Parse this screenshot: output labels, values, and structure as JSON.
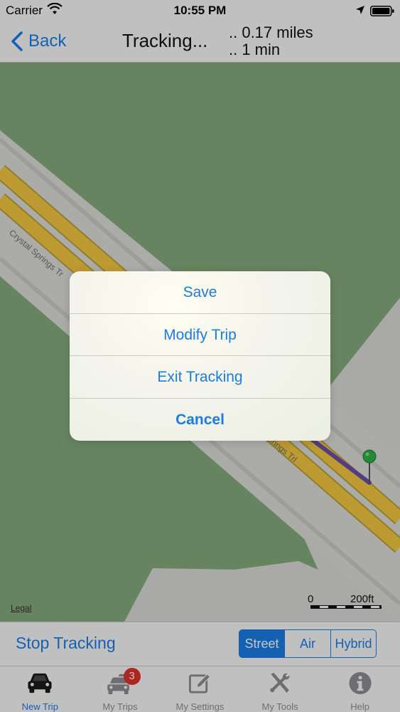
{
  "status_bar": {
    "carrier": "Carrier",
    "time": "10:55 PM",
    "wifi_icon": "wifi-icon",
    "location_icon": "location-arrow-icon",
    "battery_icon": "battery-icon"
  },
  "nav": {
    "back_label": "Back",
    "title": "Tracking...",
    "distance": ".. 0.17 miles",
    "duration": ".. 1 min"
  },
  "map": {
    "road_label_1": "Crystal Springs Tr",
    "road_label_2": "Springs Trl",
    "legal": "Legal",
    "scale_start": "0",
    "scale_end": "200ft",
    "pin_icon": "map-pin-icon",
    "colors": {
      "land": "#84aa7c",
      "road": "#f2c641",
      "route": "#6b4ea8",
      "pin": "#2fb14a"
    }
  },
  "action_sheet": {
    "items": [
      {
        "label": "Save"
      },
      {
        "label": "Modify Trip"
      },
      {
        "label": "Exit Tracking"
      },
      {
        "label": "Cancel"
      }
    ]
  },
  "toolbar": {
    "stop_label": "Stop Tracking",
    "segments": [
      {
        "label": "Street",
        "selected": true
      },
      {
        "label": "Air",
        "selected": false
      },
      {
        "label": "Hybrid",
        "selected": false
      }
    ]
  },
  "tabs": [
    {
      "label": "New Trip",
      "icon": "car-icon",
      "active": true
    },
    {
      "label": "My Trips",
      "icon": "cars-icon",
      "badge": "3",
      "active": false
    },
    {
      "label": "My Settings",
      "icon": "edit-icon",
      "active": false
    },
    {
      "label": "My Tools",
      "icon": "tools-icon",
      "active": false
    },
    {
      "label": "Help",
      "icon": "info-icon",
      "active": false
    }
  ],
  "colors": {
    "accent": "#1a7ce6",
    "badge": "#e0302a",
    "inactive": "#8e8e93"
  }
}
